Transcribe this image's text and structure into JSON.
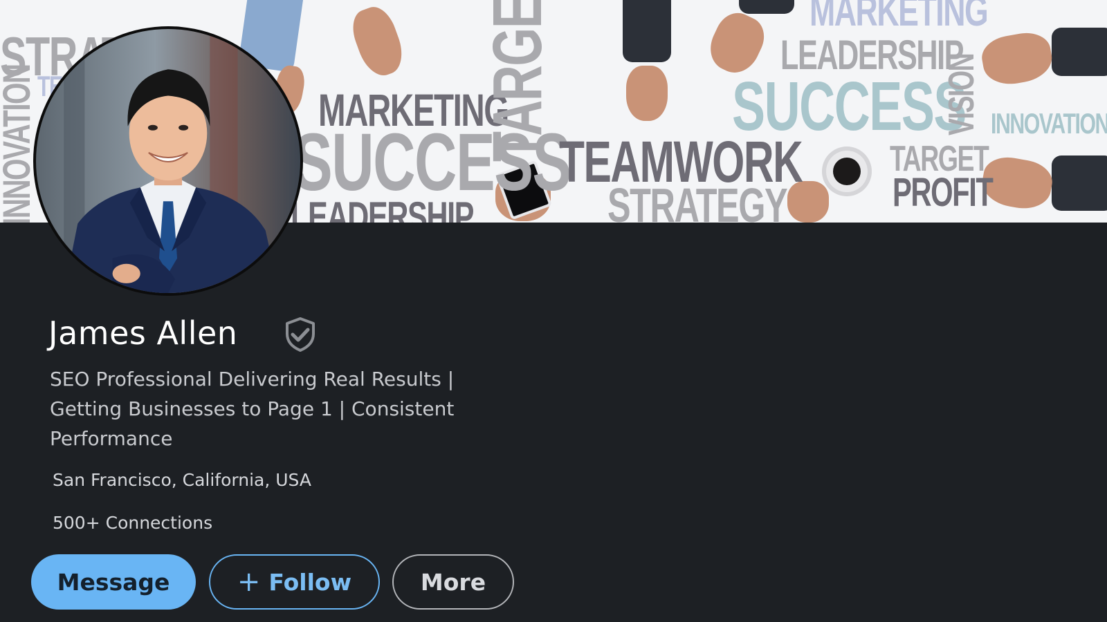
{
  "cover": {
    "words": [
      "STRATEGY",
      "MARKETING",
      "SUCCESS",
      "LEADERSHIP",
      "TARGET",
      "TEAMWORK",
      "STRATEGY",
      "MARKETING",
      "LEADERSHIP",
      "SUCCESS",
      "VISION",
      "INNOVATION",
      "TARGET",
      "PROFIT",
      "INNOVATION",
      "TE"
    ]
  },
  "profile": {
    "name": "James Allen",
    "headline": "SEO Professional Delivering Real Results | Getting Businesses to Page 1 | Consistent Performance",
    "location": "San Francisco, California, USA",
    "connections": "500+ Connections",
    "verified_icon": "shield-check-icon"
  },
  "actions": {
    "message_label": "Message",
    "follow_label": "Follow",
    "follow_icon": "plus-icon",
    "more_label": "More"
  },
  "colors": {
    "background": "#1d2024",
    "accent": "#69b5f4",
    "text_primary": "#ffffff",
    "text_secondary": "#c9cbcf"
  }
}
